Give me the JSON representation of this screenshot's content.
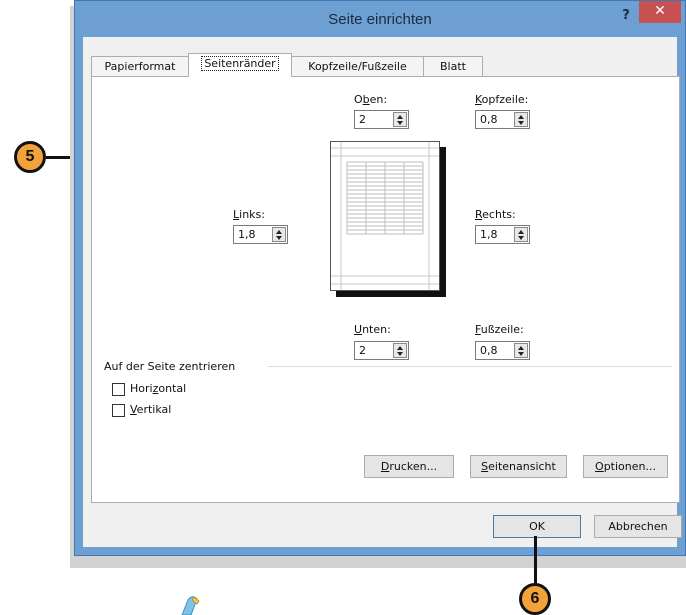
{
  "dialog": {
    "title": "Seite einrichten",
    "help_label": "?",
    "close_label": "✕"
  },
  "tabs": [
    {
      "label": "Papierformat",
      "active": false
    },
    {
      "label": "Seitenränder",
      "active": true
    },
    {
      "label": "Kopfzeile/Fußzeile",
      "active": false
    },
    {
      "label": "Blatt",
      "active": false
    }
  ],
  "margins": {
    "oben": {
      "label_pre": "O",
      "label_u": "b",
      "label_post": "en:",
      "value": "2"
    },
    "kopfzeile": {
      "label_pre": "",
      "label_u": "K",
      "label_post": "opfzeile:",
      "value": "0,8"
    },
    "links": {
      "label_pre": "",
      "label_u": "L",
      "label_post": "inks:",
      "value": "1,8"
    },
    "rechts": {
      "label_pre": "",
      "label_u": "R",
      "label_post": "echts:",
      "value": "1,8"
    },
    "unten": {
      "label_pre": "",
      "label_u": "U",
      "label_post": "nten:",
      "value": "2"
    },
    "fusszeile": {
      "label_pre": "",
      "label_u": "F",
      "label_post": "ußzeile:",
      "value": "0,8"
    }
  },
  "center": {
    "section_label": "Auf der Seite zentrieren",
    "horizontal": {
      "label_pre": "Hori",
      "label_u": "z",
      "label_post": "ontal",
      "checked": false
    },
    "vertikal": {
      "label_pre": "",
      "label_u": "V",
      "label_post": "ertikal",
      "checked": false
    }
  },
  "buttons": {
    "drucken": {
      "u": "D",
      "rest": "rucken..."
    },
    "seitenansicht": {
      "u": "S",
      "rest": "eitenansicht"
    },
    "optionen": {
      "u": "O",
      "rest": "ptionen..."
    },
    "ok": "OK",
    "abbrechen": "Abbrechen"
  },
  "callouts": {
    "five": "5",
    "six": "6"
  },
  "colors": {
    "title_bar": "#6d9fd3",
    "close_button": "#c75050",
    "callout": "#f2a23b"
  }
}
